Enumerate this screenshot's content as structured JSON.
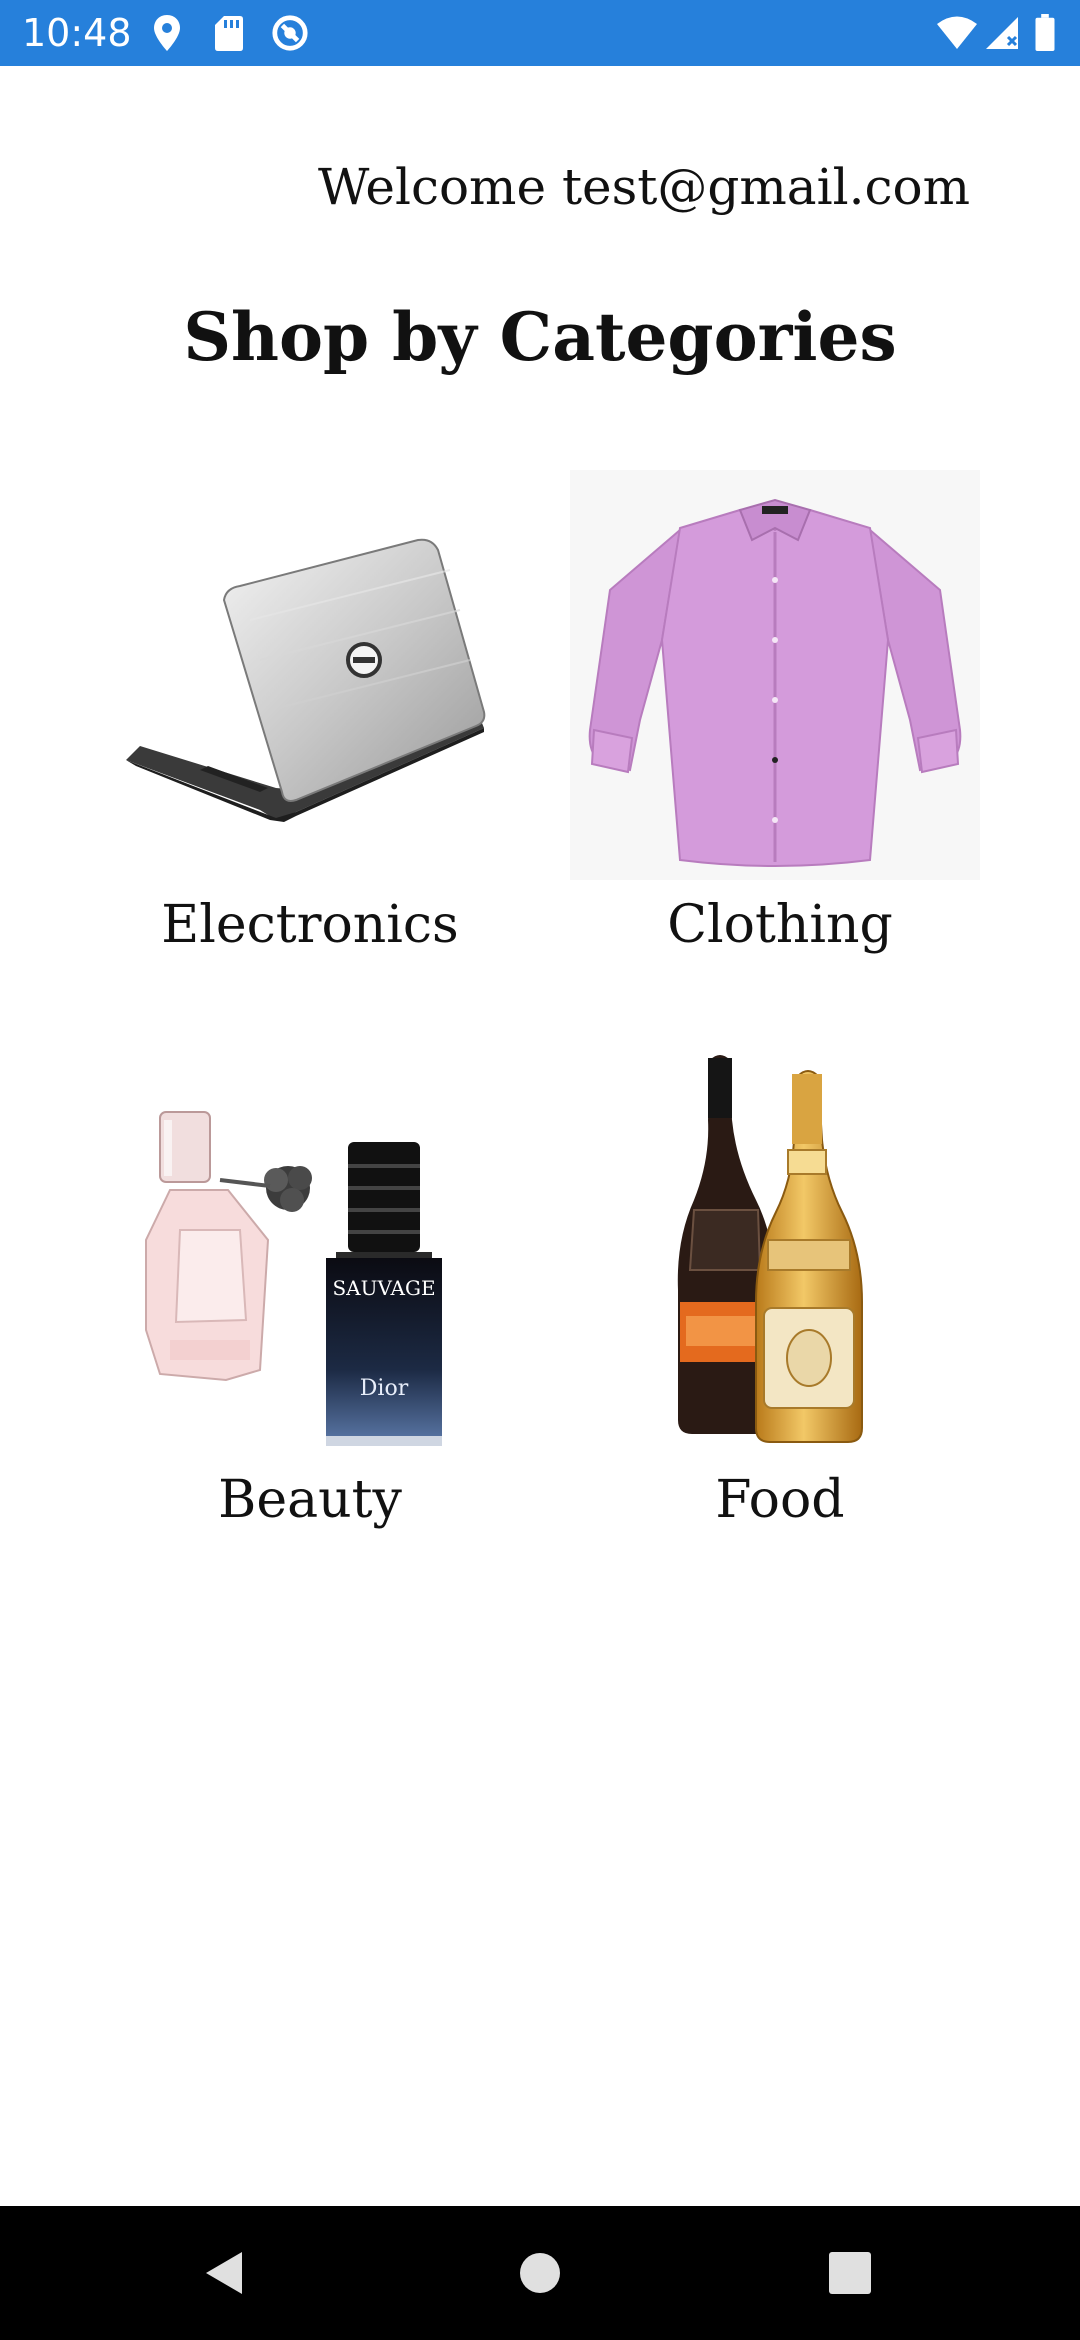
{
  "status_bar": {
    "time": "10:48",
    "background": "#2680db",
    "icons_left": [
      "location-icon",
      "sd-card-icon",
      "sync-icon"
    ],
    "icons_right": [
      "wifi-icon",
      "cellular-signal-icon",
      "battery-icon"
    ]
  },
  "header": {
    "welcome_text": "Welcome test@gmail.com",
    "title": "Shop by Categories"
  },
  "categories": [
    {
      "label": "Electronics",
      "image": "laptop-image"
    },
    {
      "label": "Clothing",
      "image": "shirt-image"
    },
    {
      "label": "Beauty",
      "image": "perfume-image"
    },
    {
      "label": "Food",
      "image": "champagne-image"
    }
  ],
  "image_text": {
    "perfume_brand": "SAUVAGE",
    "perfume_maker": "Dior"
  },
  "nav_bar": {
    "buttons": [
      "back-button",
      "home-button",
      "recents-button"
    ]
  }
}
